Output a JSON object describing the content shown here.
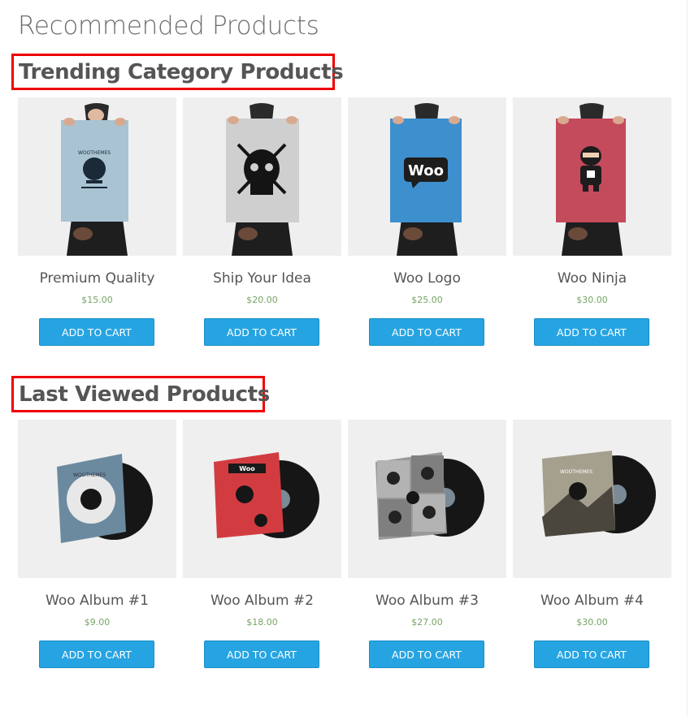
{
  "page": {
    "title": "Recommended Products"
  },
  "trending": {
    "title": "Trending Category Products",
    "products": [
      {
        "name": "Premium Quality",
        "price": "$15.00",
        "button": "ADD TO CART",
        "poster_color": "#a9c3d3",
        "image": "poster-woothemes-icon"
      },
      {
        "name": "Ship Your Idea",
        "price": "$20.00",
        "button": "ADD TO CART",
        "poster_color": "#cfcfcf",
        "image": "poster-skull-icon"
      },
      {
        "name": "Woo Logo",
        "price": "$25.00",
        "button": "ADD TO CART",
        "poster_color": "#3e8fcd",
        "image": "poster-woo-logo-icon"
      },
      {
        "name": "Woo Ninja",
        "price": "$30.00",
        "button": "ADD TO CART",
        "poster_color": "#c44b5c",
        "image": "poster-ninja-icon"
      }
    ]
  },
  "last_viewed": {
    "title": "Last Viewed Products",
    "products": [
      {
        "name": "Woo Album #1",
        "price": "$9.00",
        "button": "ADD TO CART",
        "cover_color": "#6b8aa0",
        "image": "album-woothemes-icon"
      },
      {
        "name": "Woo Album #2",
        "price": "$18.00",
        "button": "ADD TO CART",
        "cover_color": "#d23c41",
        "image": "album-woo-red-icon"
      },
      {
        "name": "Woo Album #3",
        "price": "$27.00",
        "button": "ADD TO CART",
        "cover_color": "#9a9a9a",
        "image": "album-ninjas-icon"
      },
      {
        "name": "Woo Album #4",
        "price": "$30.00",
        "button": "ADD TO CART",
        "cover_color": "#8a8576",
        "image": "album-mountain-icon"
      }
    ]
  },
  "colors": {
    "button": "#26a4e2",
    "price": "#77a464",
    "highlight_border": "#ee0000"
  }
}
